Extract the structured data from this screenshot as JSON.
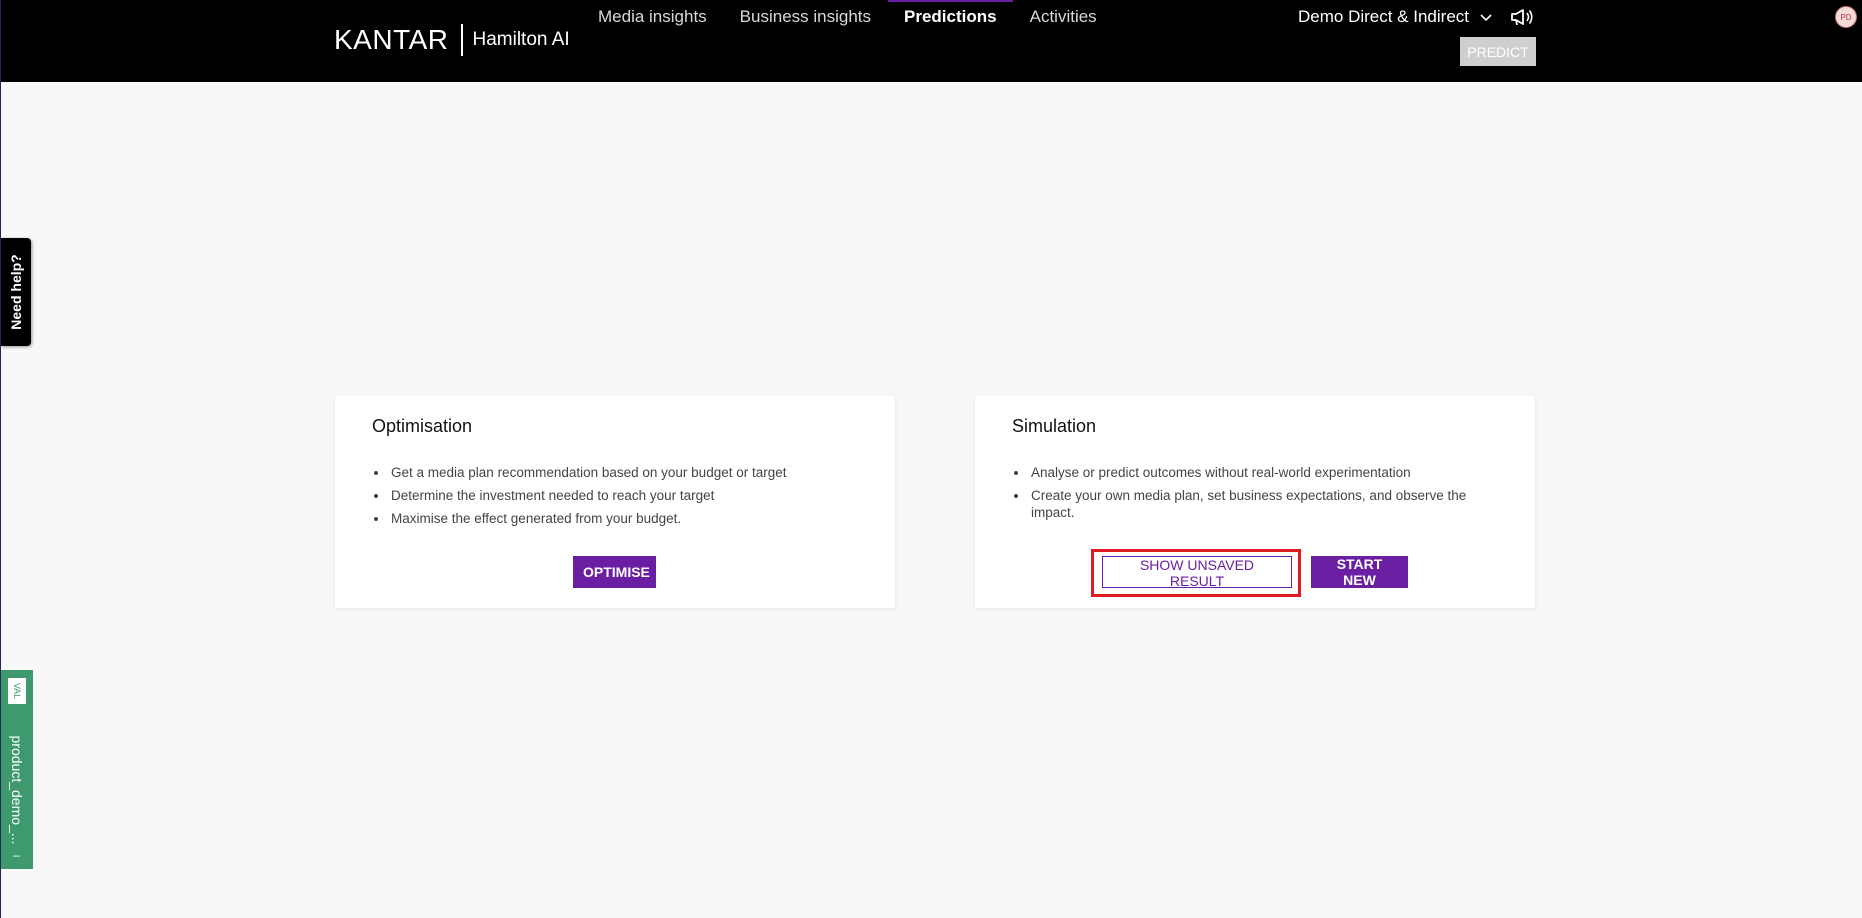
{
  "header": {
    "logo": {
      "brand": "KANTAR",
      "product": "Hamilton AI"
    },
    "nav": [
      {
        "label": "Media insights",
        "active": false
      },
      {
        "label": "Business insights",
        "active": false
      },
      {
        "label": "Predictions",
        "active": true
      },
      {
        "label": "Activities",
        "active": false
      }
    ],
    "account_label": "Demo Direct & Indirect",
    "predict_label": "PREDICT",
    "avatar_initials": "PD",
    "icons": {
      "account_dropdown": "chevron-down-icon",
      "announcements": "megaphone-icon"
    }
  },
  "side_tabs": {
    "help_label": "Need help?",
    "env_badge": "VAL",
    "env_label": "product_demo_...",
    "env_close": "–"
  },
  "optimisation": {
    "title": "Optimisation",
    "bullets": [
      "Get a media plan recommendation based on your budget or target",
      "Determine the investment needed to reach your target",
      "Maximise the effect generated from your budget."
    ],
    "button_label": "OPTIMISE"
  },
  "simulation": {
    "title": "Simulation",
    "bullets": [
      "Analyse or predict outcomes without real-world experimentation",
      "Create your own media plan, set business expectations, and observe the impact."
    ],
    "show_unsaved_label": "SHOW UNSAVED RESULT",
    "start_new_label": "START NEW"
  },
  "colors": {
    "header_bg": "#000000",
    "accent": "#6a1fa2",
    "env_tab": "#3e9a6e",
    "highlight": "#e01b24"
  }
}
